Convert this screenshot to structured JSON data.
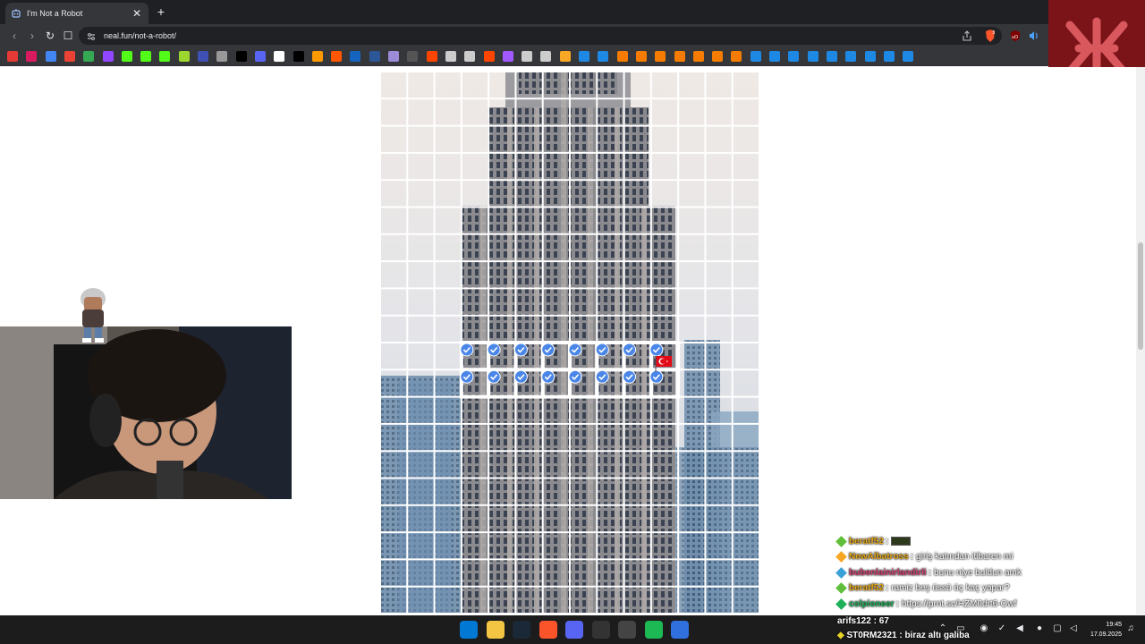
{
  "browser": {
    "tab": {
      "title": "I'm Not a Robot",
      "close_glyph": "✕"
    },
    "new_tab_glyph": "+",
    "nav": {
      "back_glyph": "‹",
      "forward_glyph": "›",
      "reload_glyph": "↻",
      "bookmark_glyph": "☐"
    },
    "url": "neal.fun/not-a-robot/",
    "bookmark_colors": [
      "#e53935",
      "#d81b60",
      "#4285f4",
      "#ea4335",
      "#34a853",
      "#9146ff",
      "#53fc18",
      "#53fc18",
      "#53fc18",
      "#9cd72f",
      "#3f51b5",
      "#999999",
      "#000000",
      "#5865f2",
      "#ffffff",
      "#000000",
      "#ff9900",
      "#ff5700",
      "#1565c0",
      "#2b5797",
      "#9c8bd9",
      "#555555",
      "#ff4500",
      "#cccccc",
      "#cccccc",
      "#ff4500",
      "#a259ff",
      "#cccccc",
      "#cccccc",
      "#f9a825",
      "#1e88e5",
      "#1e88e5",
      "#f57c00",
      "#f57c00",
      "#f57c00",
      "#f57c00",
      "#f57c00",
      "#f57c00",
      "#f57c00",
      "#1e88e5",
      "#1e88e5",
      "#1e88e5",
      "#1e88e5",
      "#1e88e5",
      "#1e88e5",
      "#1e88e5",
      "#1e88e5",
      "#1e88e5"
    ]
  },
  "overlay": {
    "logo_glyph": "Ж"
  },
  "captcha": {
    "flag_icon": "turkey-flag-icon",
    "grid_columns": 14,
    "grid_rows": 20,
    "checked_rows": [
      10,
      11
    ],
    "checked_cols": [
      3,
      4,
      5,
      6,
      7,
      8,
      9,
      10
    ]
  },
  "chat": [
    {
      "user": "beratf52",
      "user_color": "#e6a817",
      "badge_color": "#5fbf3b",
      "message": "",
      "emote": true
    },
    {
      "user": "NewAlbatross",
      "user_color": "#e6a817",
      "badge_color": "#f5a623",
      "message": "giriş katından itibaren mi",
      "emote": false
    },
    {
      "user": "bubenlainirlandirli",
      "user_color": "#d13d6d",
      "badge_color": "#3aa0d8",
      "message": "bunu niye buldun amk",
      "emote": false
    },
    {
      "user": "beratf52",
      "user_color": "#e6a817",
      "badge_color": "#5fbf3b",
      "message": "ramiz beş üssü üç kaç yapar?",
      "emote": false
    },
    {
      "user": "colpioneer",
      "user_color": "#1fb05a",
      "badge_color": "#1fb05a",
      "message": "https://prnt.sc/HZM0drt6-Owf",
      "emote": false
    }
  ],
  "ticker": [
    {
      "text": "arifs122 : 67",
      "color": "#ffffff"
    },
    {
      "text": "ST0RM2321 : biraz altı galiba",
      "user_color": "#e6d22a"
    }
  ],
  "taskbar": {
    "time": "19:45",
    "date": "17.09.2025",
    "app_colors": [
      "#0078d4",
      "#f4c542",
      "#1b2838",
      "#fb542b",
      "#5865f2",
      "#333333",
      "#444444",
      "#1db954",
      "#2f6fde"
    ]
  }
}
